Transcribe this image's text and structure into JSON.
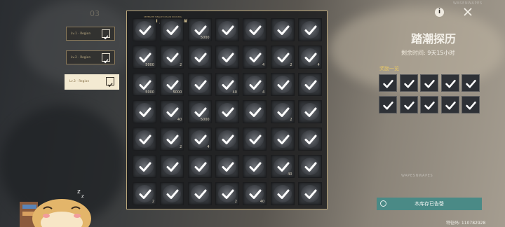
{
  "side_tabs": {
    "number": "03",
    "items": [
      {
        "label": "Lv.1 · Region"
      },
      {
        "label": "Lv.2 · Region"
      },
      {
        "label": "Lv.3 · Region"
      }
    ]
  },
  "board": {
    "title": "Wefl XSN jAKSENSWIQ",
    "subtitle": "SEPERATE SINGLE KUSAIN WUXUNG",
    "rows": [
      [
        "",
        "",
        "5000",
        "",
        "",
        "",
        ""
      ],
      [
        "5000",
        "2",
        "",
        "",
        "4",
        "2",
        "4"
      ],
      [
        "5000",
        "5000",
        "",
        "40",
        "4",
        "",
        ""
      ],
      [
        "",
        "40",
        "5000",
        "",
        "",
        "2",
        ""
      ],
      [
        "",
        "2",
        "4",
        "",
        "",
        "",
        ""
      ],
      [
        "",
        "",
        "",
        "",
        "",
        "40",
        ""
      ],
      [
        "2",
        "",
        "",
        "2",
        "40",
        "",
        ""
      ]
    ]
  },
  "panel": {
    "title": "踏潮探历",
    "remaining_label": "剩余时间:",
    "remaining_value": "9天15小时",
    "rewards_label": "奖励一览",
    "rewards": [
      "",
      "",
      "",
      "",
      "",
      "",
      "",
      "",
      "",
      ""
    ],
    "status_text": "本库存已告罄"
  },
  "uid": "特征码: 110782928",
  "watermark_top": "WASENWAPES",
  "watermark_bottom": "WAPESNWAPES",
  "colors": {
    "accent": "#e8c866",
    "status": "#4a8a86",
    "frame": "#b8a57a"
  }
}
